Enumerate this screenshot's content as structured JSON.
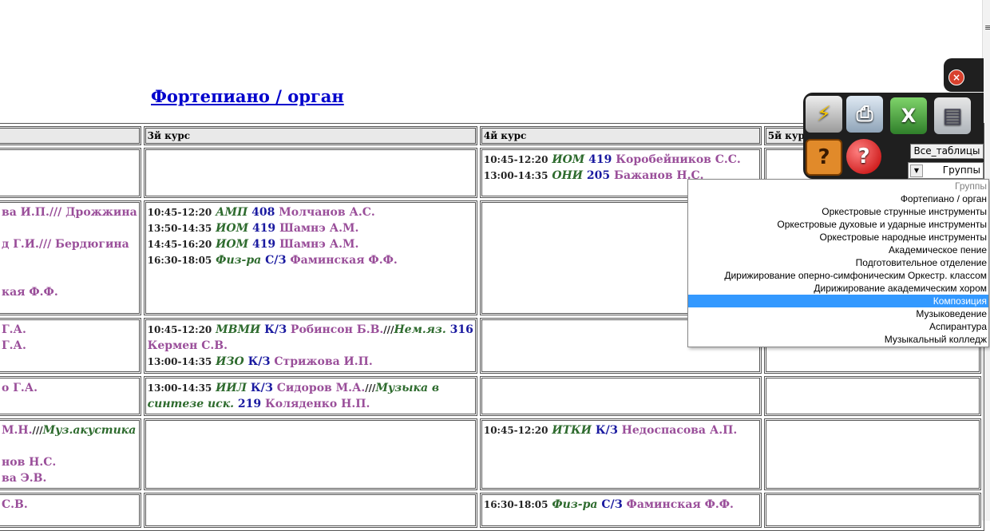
{
  "page": {
    "title": "Фортепиано / орган"
  },
  "table": {
    "headers": [
      "",
      "3й курс",
      "4й курс",
      "5й курс"
    ],
    "rows": [
      {
        "c0": [],
        "c1": [],
        "c2": [
          {
            "time": "10:45-12:20",
            "subject": "ИОМ",
            "room": "419",
            "teacher": "Коробейников С.С."
          },
          {
            "time": "13:00-14:35",
            "subject": "ОНИ",
            "room": "205",
            "teacher": "Бажанов Н.С."
          }
        ],
        "c3": []
      },
      {
        "c0": [
          "ва И.П./// Дрожжина",
          "",
          "д Г.И./// Бердюгина",
          "",
          "",
          "кая Ф.Ф."
        ],
        "c1": [
          {
            "time": "10:45-12:20",
            "subject": "АМП",
            "room": "408",
            "teacher": "Молчанов А.С."
          },
          {
            "time": "13:50-14:35",
            "subject": "ИОМ",
            "room": "419",
            "teacher": "Шамнэ А.М."
          },
          {
            "time": "14:45-16:20",
            "subject": "ИОМ",
            "room": "419",
            "teacher": "Шамнэ А.М."
          },
          {
            "time": "16:30-18:05",
            "subject": "Физ-ра",
            "room": "С/З",
            "teacher": "Фаминская Ф.Ф."
          }
        ],
        "c2": [],
        "c3": []
      },
      {
        "c0": [
          "Г.А.",
          "Г.А."
        ],
        "c1_text": {
          "l1_time": "10:45-12:20",
          "l1_subject": "МВМИ",
          "l1_room": "К/З",
          "l1_teacher": "Робинсон Б.В.",
          "l1_sep": "///",
          "l1_subject2": "Нем.яз.",
          "l1_room2": "316",
          "l2_teacher2": "Кермен С.В.",
          "l3_time": "13:00-14:35",
          "l3_subject": "ИЗО",
          "l3_room": "К/З",
          "l3_teacher": "Стрижова И.П."
        },
        "c2": [],
        "c3": []
      },
      {
        "c0": [
          "о Г.А."
        ],
        "c1_text": {
          "time": "13:00-14:35",
          "subject": "ИИЛ",
          "room": "К/З",
          "teacher": "Сидоров М.А.",
          "sep": "///",
          "subject2_a": "Музыка в",
          "subject2_b": "синтезе иск.",
          "room2": "219",
          "teacher2": "Коляденко Н.П."
        },
        "c2": [],
        "c3": []
      },
      {
        "c0_text": {
          "l1_teacher": "М.Н.",
          "l1_sep": "///",
          "l1_subject": "Муз.акустика",
          "l3": "нов Н.С.",
          "l4": "ва Э.В."
        },
        "c1": [],
        "c2": [
          {
            "time": "10:45-12:20",
            "subject": "ИТКИ",
            "room": "К/З",
            "teacher": "Недоспасова А.П."
          }
        ],
        "c3": []
      },
      {
        "c0": [
          "С.В."
        ],
        "c1": [],
        "c2": [
          {
            "time": "16:30-18:05",
            "subject": "Физ-ра",
            "room": "С/З",
            "teacher": "Фаминская Ф.Ф."
          }
        ],
        "c3": []
      }
    ]
  },
  "toolbar": {
    "close_glyph": "×",
    "all_tables_label": "Все_таблицы",
    "group_select_value": "Группы",
    "icons": [
      "print-flash-icon",
      "printer-icon",
      "excel-icon",
      "save-disk-icon",
      "question-block-icon",
      "help-search-icon"
    ],
    "glyphs": {
      "print1": "⚡",
      "print2": "⎙",
      "excel": "X",
      "save": "▤",
      "question": "?",
      "help": "?"
    }
  },
  "dropdown": {
    "selected_index": 9,
    "options": [
      "Группы",
      "Фортепиано / орган",
      "Оркестровые струнные инструменты",
      "Оркестровые духовые и ударные инструменты",
      "Оркестровые народные инструменты",
      "Академическое пение",
      "Подготовительное отделение",
      "Дирижирование оперно-симфоническим Оркестр. классом",
      "Дирижирование академическим хором",
      "Композиция",
      "Музыковедение",
      "Аспирантура",
      "Музыкальный колледж"
    ],
    "colors": {
      "selected_bg": "#3399ff",
      "placeholder": "#808080"
    }
  }
}
